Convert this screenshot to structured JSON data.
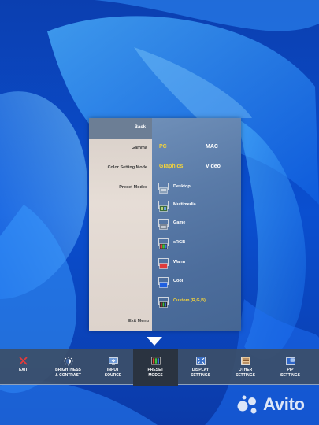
{
  "osd": {
    "back_label": "Back",
    "labels": {
      "gamma": "Gamma",
      "color_setting_mode": "Color Setting Mode",
      "preset_modes": "Preset Modes",
      "exit_menu": "Exit Menu"
    },
    "gamma_options": {
      "pc": "PC",
      "mac": "MAC",
      "selected": "PC"
    },
    "color_mode_options": {
      "graphics": "Graphics",
      "video": "Video",
      "selected": "Graphics"
    },
    "presets": [
      {
        "label": "Desktop",
        "icon": "desktop-icon",
        "selected": false
      },
      {
        "label": "Multimedia",
        "icon": "multimedia-icon",
        "selected": false
      },
      {
        "label": "Game",
        "icon": "game-icon",
        "selected": false
      },
      {
        "label": "sRGB",
        "icon": "srgb-icon",
        "selected": false
      },
      {
        "label": "Warm",
        "icon": "warm-icon",
        "selected": false
      },
      {
        "label": "Cool",
        "icon": "cool-icon",
        "selected": false
      },
      {
        "label": "Custom (R,G,B)",
        "icon": "custom-rgb-icon",
        "selected": true
      }
    ]
  },
  "toolbar": {
    "items": [
      {
        "label": "EXIT",
        "icon": "close-icon",
        "active": false
      },
      {
        "label": "BRIGHTNESS\n& CONTRAST",
        "icon": "brightness-icon",
        "active": false
      },
      {
        "label": "INPUT\nSOURCE",
        "icon": "input-source-icon",
        "active": false
      },
      {
        "label": "PRESET\nMODES",
        "icon": "preset-modes-icon",
        "active": true
      },
      {
        "label": "DISPLAY\nSETTINGS",
        "icon": "display-settings-icon",
        "active": false
      },
      {
        "label": "OTHER\nSETTINGS",
        "icon": "other-settings-icon",
        "active": false
      },
      {
        "label": "PIP\nSETTINGS",
        "icon": "pip-settings-icon",
        "active": false
      }
    ]
  },
  "watermark": {
    "text": "Avito"
  },
  "colors": {
    "selected_option": "#f5d43a",
    "exit_icon": "#e23b3b",
    "panel_right": "#5a7ba8",
    "panel_left": "#ddd3cc"
  }
}
